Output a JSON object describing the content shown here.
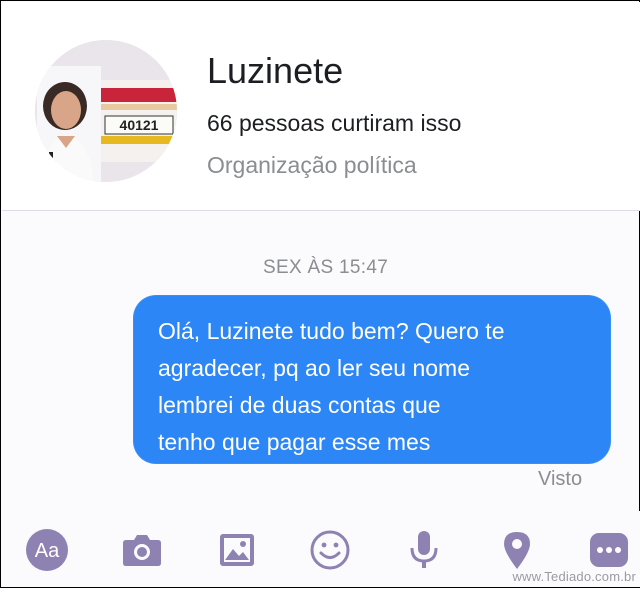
{
  "header": {
    "page_name": "Luzinete",
    "likes": "66 pessoas curtiram isso",
    "category": "Organização política",
    "avatar_poster_text": "40121"
  },
  "conversation": {
    "timestamp": "SEX ÀS 15:47",
    "message_lines": [
      "Olá, Luzinete tudo bem? Quero te",
      "agradecer, pq ao ler seu nome",
      "lembrei de duas contas que",
      "tenho que pagar esse mes"
    ],
    "seen_label": "Visto"
  },
  "toolbar": {
    "text_button_label": "Aa",
    "icons": [
      "aa-icon",
      "camera-icon",
      "image-icon",
      "emoji-icon",
      "microphone-icon",
      "location-pin-icon",
      "more-icon"
    ],
    "icon_color": "#8e82b3"
  },
  "watermark": "www.Tediado.com.br",
  "colors": {
    "bubble": "#2d86f5",
    "muted_text": "#8a8d91",
    "toolbar_icon": "#8e82b3"
  }
}
